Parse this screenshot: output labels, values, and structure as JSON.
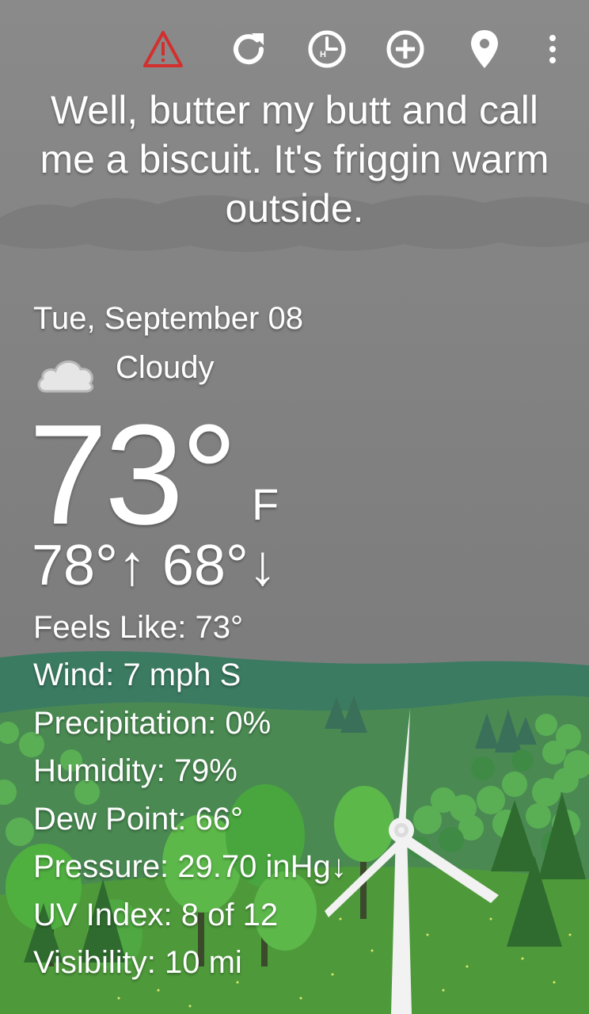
{
  "toolbar": {
    "items": [
      {
        "name": "alert-icon",
        "color": "#d32f2f"
      },
      {
        "name": "refresh-icon",
        "color": "#ffffff"
      },
      {
        "name": "hourly-clock-icon",
        "color": "#ffffff",
        "glyph": "H"
      },
      {
        "name": "add-location-icon",
        "color": "#ffffff"
      },
      {
        "name": "location-pin-icon",
        "color": "#ffffff"
      },
      {
        "name": "overflow-menu-icon",
        "color": "#ffffff"
      }
    ]
  },
  "headline": "Well, butter my butt and call me a biscuit. It's friggin warm outside.",
  "current": {
    "date": "Tue, September 08",
    "condition": "Cloudy",
    "condition_icon": "cloud-icon",
    "temperature": "73°",
    "unit": "F",
    "high_low": "78°↑ 68°↓"
  },
  "details": [
    "Feels Like: 73°",
    "Wind: 7 mph S",
    "Precipitation: 0%",
    "Humidity: 79%",
    "Dew Point: 66°",
    "Pressure: 29.70 inHg↓",
    "UV Index: 8 of 12",
    "Visibility: 10 mi"
  ],
  "colors": {
    "sky": "#858585",
    "hill_far": "#3a7a60",
    "meadow": "#4f9a3a",
    "tree_light": "#5db84a",
    "tree_dark": "#2f6e2f",
    "alert": "#d32f2f"
  }
}
